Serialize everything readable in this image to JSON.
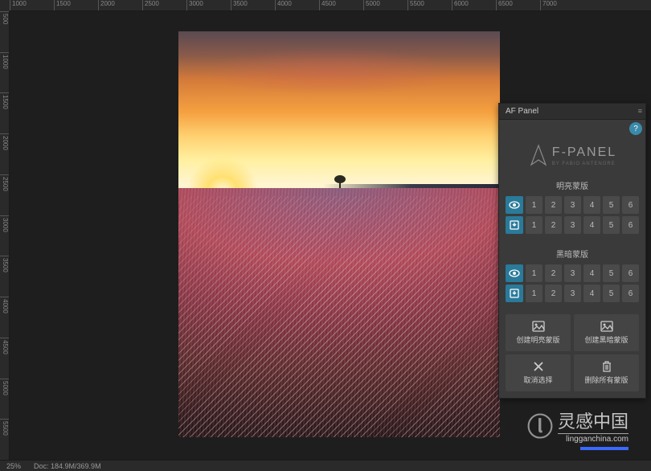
{
  "ruler_h": [
    "1000",
    "1500",
    "2000",
    "2500",
    "3000",
    "3500",
    "4000",
    "4500",
    "5000",
    "5500",
    "6000",
    "6500",
    "7000"
  ],
  "ruler_v": [
    "500",
    "1000",
    "1500",
    "2000",
    "2500",
    "3000",
    "3500",
    "4000",
    "4500",
    "5000",
    "5500"
  ],
  "status": {
    "zoom": "25%",
    "doc": "Doc: 184.9M/369.9M"
  },
  "panel": {
    "tab_title": "AF Panel",
    "logo_main": "F-PANEL",
    "logo_sub": "BY FABIO ANTENORE",
    "help": "?",
    "group_light": {
      "title": "明亮蒙版",
      "nums": [
        "1",
        "2",
        "3",
        "4",
        "5",
        "6"
      ]
    },
    "group_dark": {
      "title": "黑暗蒙版",
      "nums": [
        "1",
        "2",
        "3",
        "4",
        "5",
        "6"
      ]
    },
    "actions": {
      "a1": "创建明亮蒙版",
      "a2": "创建黑暗蒙版",
      "a3": "取消选择",
      "a4": "删除所有蒙版"
    }
  },
  "watermark": {
    "main": "灵感中国",
    "sub": "lingganchina.com"
  }
}
